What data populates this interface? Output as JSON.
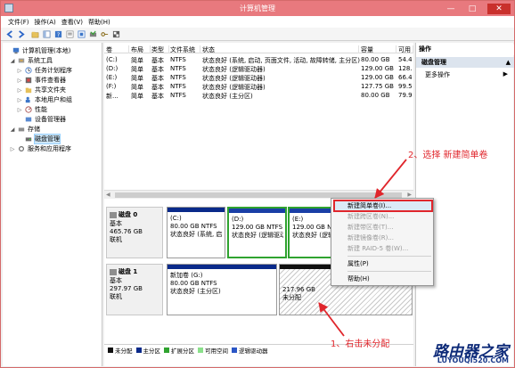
{
  "window": {
    "title": "计算机管理"
  },
  "menubar": [
    "文件(F)",
    "操作(A)",
    "查看(V)",
    "帮助(H)"
  ],
  "tree": {
    "items": [
      {
        "label": "计算机管理(本地)",
        "icon": "computer-icon",
        "level": 0,
        "expander": ""
      },
      {
        "label": "系统工具",
        "icon": "tools-icon",
        "level": 1,
        "expander": "◢"
      },
      {
        "label": "任务计划程序",
        "icon": "clock-icon",
        "level": 2,
        "expander": "▷"
      },
      {
        "label": "事件查看器",
        "icon": "event-icon",
        "level": 2,
        "expander": "▷"
      },
      {
        "label": "共享文件夹",
        "icon": "folder-icon",
        "level": 2,
        "expander": "▷"
      },
      {
        "label": "本地用户和组",
        "icon": "users-icon",
        "level": 2,
        "expander": "▷"
      },
      {
        "label": "性能",
        "icon": "performance-icon",
        "level": 2,
        "expander": "▷"
      },
      {
        "label": "设备管理器",
        "icon": "device-icon",
        "level": 2,
        "expander": ""
      },
      {
        "label": "存储",
        "icon": "storage-icon",
        "level": 1,
        "expander": "◢"
      },
      {
        "label": "磁盘管理",
        "icon": "disk-icon",
        "level": 2,
        "expander": "",
        "selected": true
      },
      {
        "label": "服务和应用程序",
        "icon": "services-icon",
        "level": 1,
        "expander": "▷"
      }
    ]
  },
  "volumes": {
    "headers": [
      "卷",
      "布局",
      "类型",
      "文件系统",
      "状态",
      "容量",
      "可用"
    ],
    "rows": [
      [
        "(C:)",
        "简单",
        "基本",
        "NTFS",
        "状态良好 (系统, 启动, 页面文件, 活动, 故障转储, 主分区)",
        "80.00 GB",
        "54.4"
      ],
      [
        "(D:)",
        "简单",
        "基本",
        "NTFS",
        "状态良好 (逻辑驱动器)",
        "129.00 GB",
        "128."
      ],
      [
        "(E:)",
        "简单",
        "基本",
        "NTFS",
        "状态良好 (逻辑驱动器)",
        "129.00 GB",
        "66.4"
      ],
      [
        "(F:)",
        "简单",
        "基本",
        "NTFS",
        "状态良好 (逻辑驱动器)",
        "127.75 GB",
        "99.5"
      ],
      [
        "新...",
        "简单",
        "基本",
        "NTFS",
        "状态良好 (主分区)",
        "80.00 GB",
        "79.9"
      ]
    ]
  },
  "disks": [
    {
      "name": "磁盘 0",
      "type": "基本",
      "size": "465.76 GB",
      "status": "联机",
      "partitions": [
        {
          "name": "(C:)",
          "size": "80.00 GB NTFS",
          "status": "状态良好 (系统, 启"
        },
        {
          "name": "(D:)",
          "size": "129.00 GB NTFS",
          "status": "状态良好 (逻辑驱动"
        },
        {
          "name": "(E:)",
          "size": "129.00 GB NTFS",
          "status": "状态良好 (逻辑驱"
        }
      ]
    },
    {
      "name": "磁盘 1",
      "type": "基本",
      "size": "297.97 GB",
      "status": "联机",
      "partitions": [
        {
          "name": "新加卷 (G:)",
          "size": "80.00 GB NTFS",
          "status": "状态良好 (主分区)"
        },
        {
          "name": "",
          "size": "217.96 GB",
          "status": "未分配"
        }
      ]
    }
  ],
  "legend": [
    {
      "label": "未分配",
      "color": "#101010"
    },
    {
      "label": "主分区",
      "color": "#0a2a8a"
    },
    {
      "label": "扩展分区",
      "color": "#2fa32f"
    },
    {
      "label": "可用空间",
      "color": "#8be08b"
    },
    {
      "label": "逻辑驱动器",
      "color": "#2b56c6"
    }
  ],
  "actions": {
    "header": "操作",
    "section": "磁盘管理",
    "item": "更多操作"
  },
  "context_menu": {
    "items": [
      {
        "label": "新建简单卷(I)...",
        "enabled": true,
        "highlighted": true
      },
      {
        "label": "新建跨区卷(N)...",
        "enabled": false
      },
      {
        "label": "新建带区卷(T)...",
        "enabled": false
      },
      {
        "label": "新建镜像卷(R)...",
        "enabled": false
      },
      {
        "label": "新建 RAID-5 卷(W)...",
        "enabled": false
      },
      {
        "label": "属性(P)",
        "enabled": true
      },
      {
        "label": "帮助(H)",
        "enabled": true
      }
    ]
  },
  "annotations": {
    "step1": "1、右击未分配",
    "step2": "2、选择 新建简单卷"
  },
  "watermark": {
    "line1": "路由器之家",
    "line2": "LUYOUQI520.COM"
  },
  "colors": {
    "titlebar": "#e8797e",
    "annotation": "#e0262c",
    "primary_partition": "#0a2a8a",
    "unallocated": "#101010"
  }
}
